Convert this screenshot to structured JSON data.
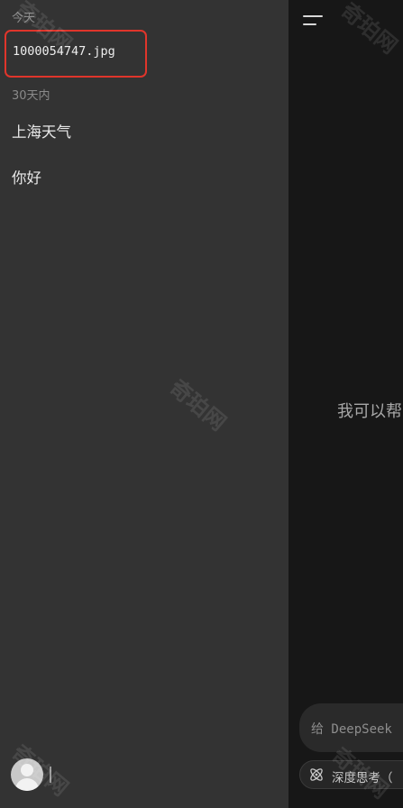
{
  "sidebar": {
    "section_today": "今天",
    "file_item": "1000054747.jpg",
    "section_30days": "30天内",
    "chats": [
      {
        "label": "上海天气"
      },
      {
        "label": "你好"
      }
    ]
  },
  "main": {
    "help_text": "我可以帮",
    "input_placeholder": "给 DeepSeek",
    "deep_think_label": "深度思考（"
  },
  "watermark": "奇珀网",
  "colors": {
    "highlight_border": "#e0352b",
    "sidebar_bg": "#333333",
    "main_bg": "#171717"
  }
}
